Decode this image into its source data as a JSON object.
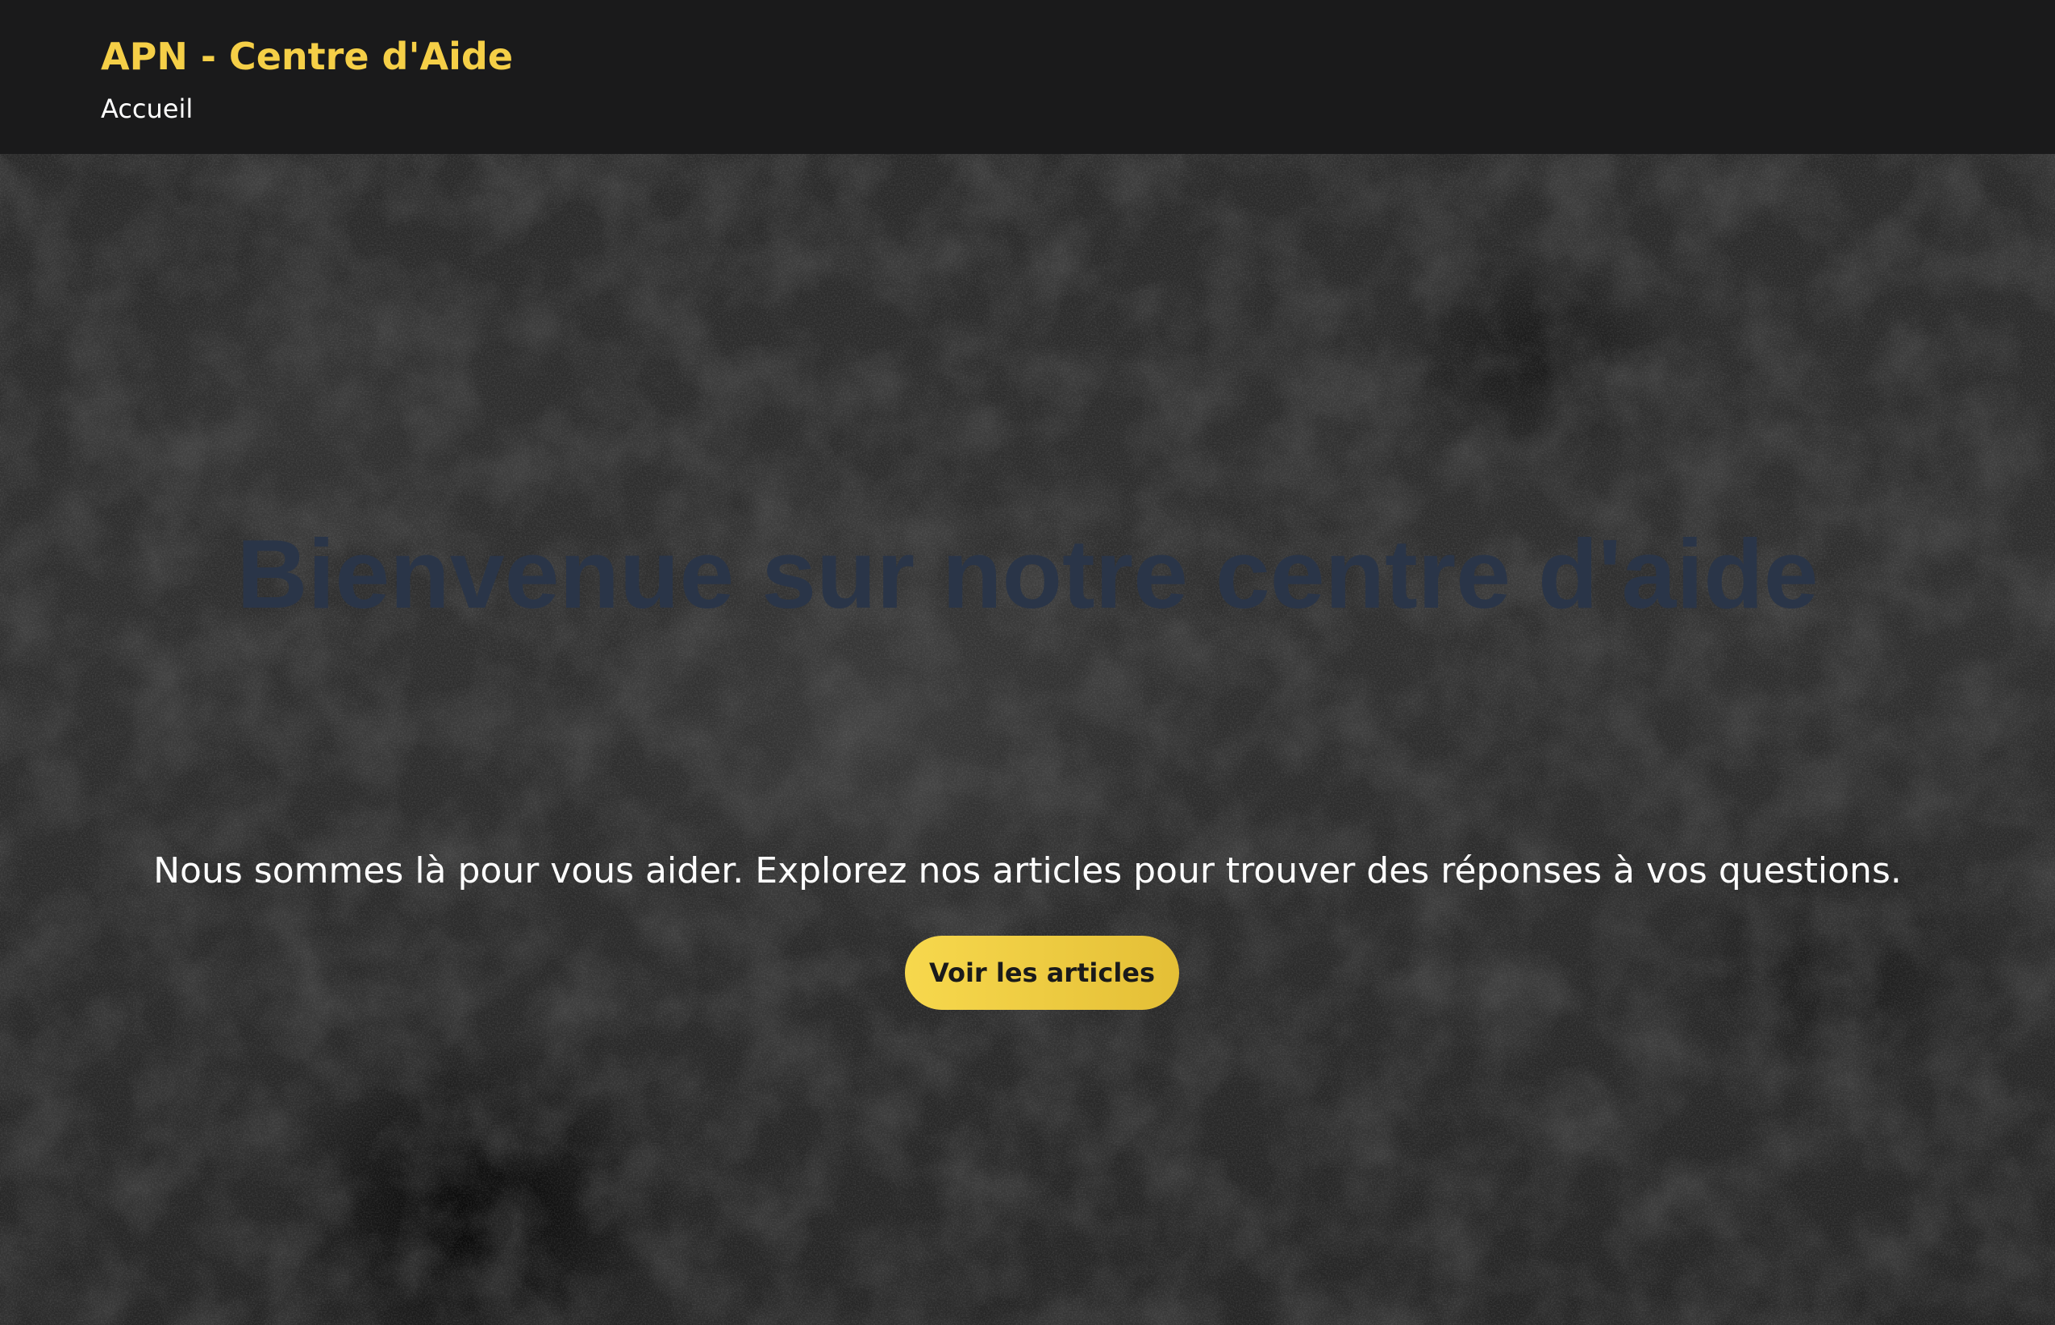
{
  "header": {
    "site_title": "APN - Centre d'Aide",
    "nav": {
      "home_label": "Accueil"
    }
  },
  "hero": {
    "title": "Bienvenue sur notre centre d'aide",
    "subtitle": "Nous sommes là pour vous aider. Explorez nos articles pour trouver des réponses à vos questions.",
    "cta_label": "Voir les articles"
  },
  "colors": {
    "accent": "#f5cf47",
    "header_bg": "#1a1a1b",
    "title_color": "#2a3548"
  }
}
